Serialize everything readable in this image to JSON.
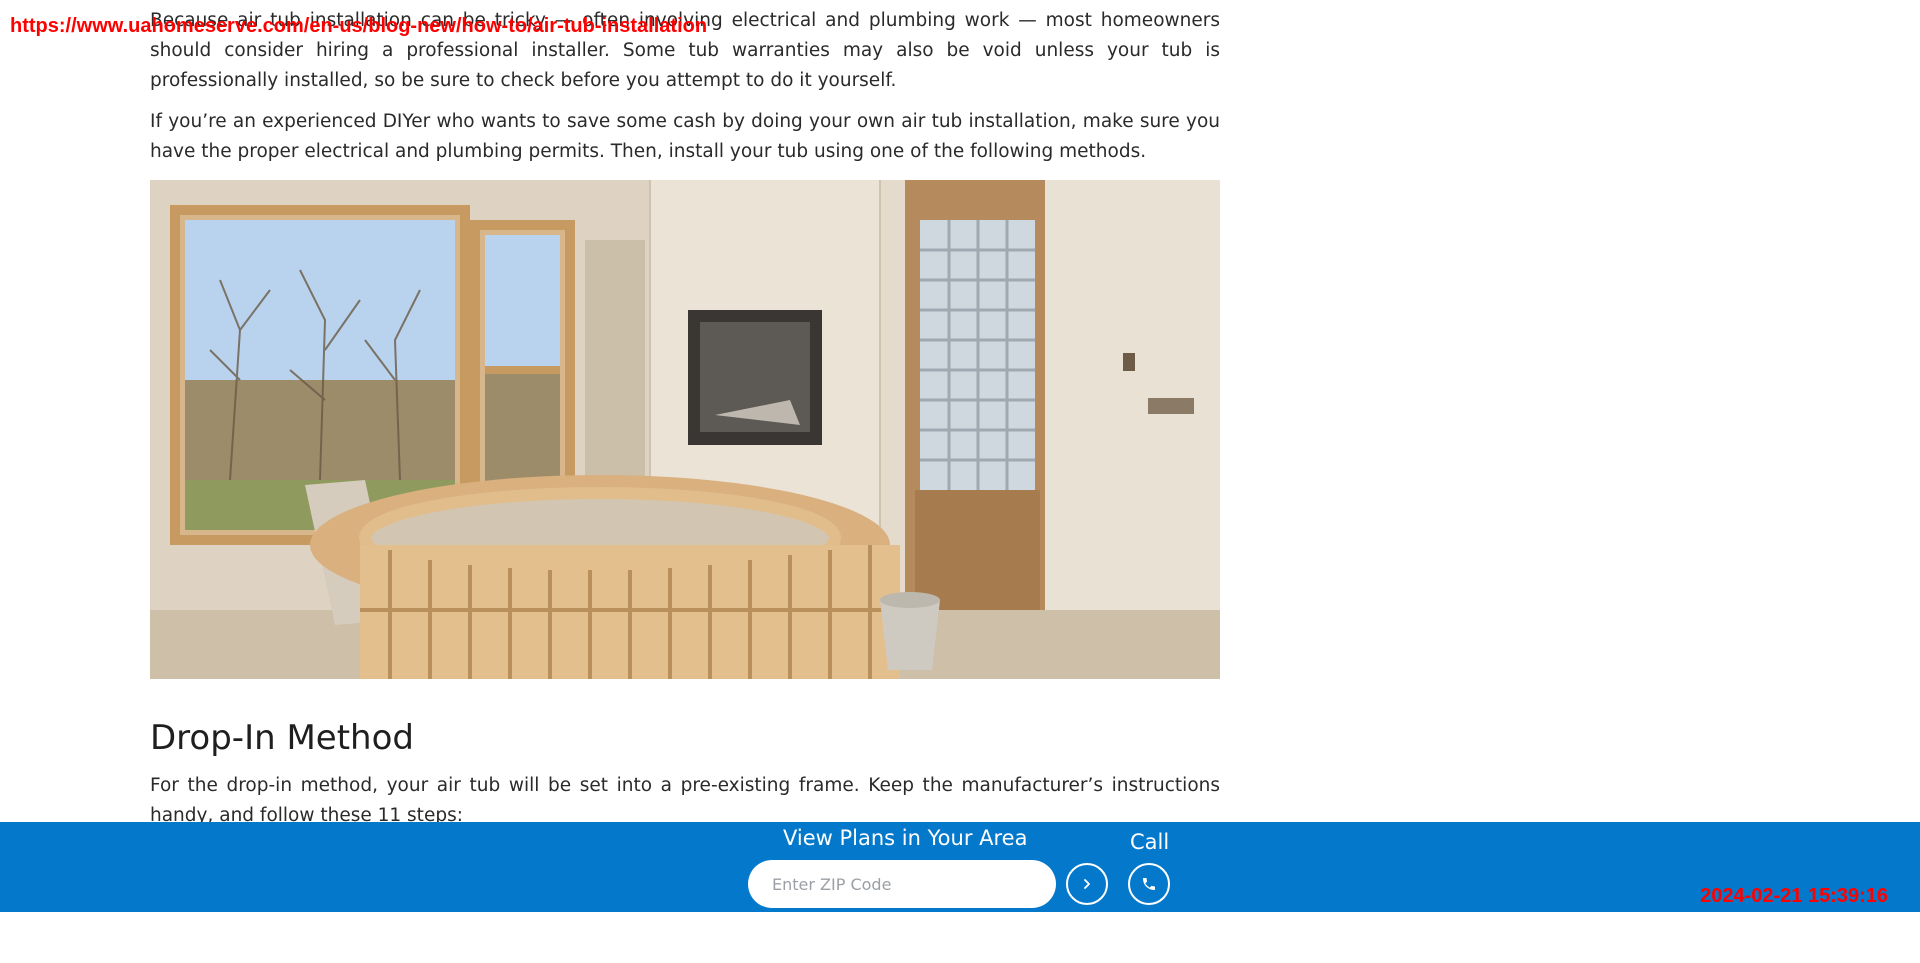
{
  "overlay": {
    "url": "https://www.uahomeserve.com/en-us/blog-new/how-to/air-tub-installation",
    "timestamp": "2024-02-21 15:39:16"
  },
  "article": {
    "paragraphs": [
      "Because air tub installation can be tricky — often involving electrical and plumbing work — most homeowners should consider hiring a professional installer. Some tub warranties may also be void unless your tub is professionally installed, so be sure to check before you attempt to do it yourself.",
      "If you’re an experienced DIYer who wants to save some cash by doing your own air tub installation, make sure you have the proper electrical and plumbing permits. Then, install your tub using one of the following methods.",
      "For the drop-in method, your air tub will be set into a pre-existing frame. Keep the manufacturer’s instructions handy, and follow these 11 steps:"
    ],
    "section_heading": "Drop-In Method"
  },
  "footer": {
    "plans_title": "View Plans in Your Area",
    "zip_placeholder": "Enter ZIP Code",
    "zip_value": "",
    "call_label": "Call",
    "go_icon": "chevron-right-icon",
    "call_icon": "phone-icon",
    "background_color": "#0479cc"
  }
}
